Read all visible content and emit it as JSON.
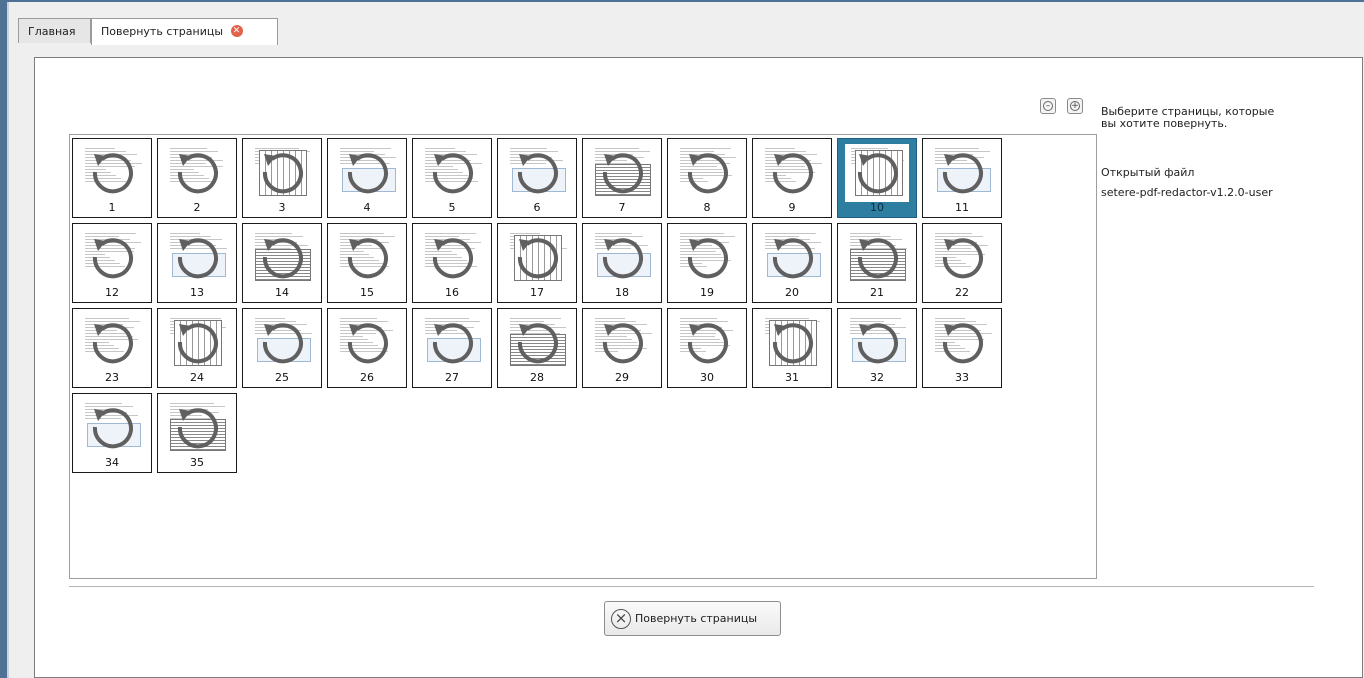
{
  "tabs": [
    {
      "label": "Главная",
      "active": false
    },
    {
      "label": "Повернуть страницы",
      "active": true,
      "closable": true
    }
  ],
  "colors": {
    "accent": "#4f7194",
    "selected_tile": "#2d7ea1",
    "tab_close": "#e2624a",
    "rotate_icon": "#606060"
  },
  "zoom": {
    "out_icon": "zoom-out-icon",
    "in_icon": "zoom-in-icon"
  },
  "pages": [
    {
      "number": "1",
      "selected": false
    },
    {
      "number": "2",
      "selected": false
    },
    {
      "number": "3",
      "selected": false
    },
    {
      "number": "4",
      "selected": false
    },
    {
      "number": "5",
      "selected": false
    },
    {
      "number": "6",
      "selected": false
    },
    {
      "number": "7",
      "selected": false
    },
    {
      "number": "8",
      "selected": false
    },
    {
      "number": "9",
      "selected": false
    },
    {
      "number": "10",
      "selected": true
    },
    {
      "number": "11",
      "selected": false
    },
    {
      "number": "12",
      "selected": false
    },
    {
      "number": "13",
      "selected": false
    },
    {
      "number": "14",
      "selected": false
    },
    {
      "number": "15",
      "selected": false
    },
    {
      "number": "16",
      "selected": false
    },
    {
      "number": "17",
      "selected": false
    },
    {
      "number": "18",
      "selected": false
    },
    {
      "number": "19",
      "selected": false
    },
    {
      "number": "20",
      "selected": false
    },
    {
      "number": "21",
      "selected": false
    },
    {
      "number": "22",
      "selected": false
    },
    {
      "number": "23",
      "selected": false
    },
    {
      "number": "24",
      "selected": false
    },
    {
      "number": "25",
      "selected": false
    },
    {
      "number": "26",
      "selected": false
    },
    {
      "number": "27",
      "selected": false
    },
    {
      "number": "28",
      "selected": false
    },
    {
      "number": "29",
      "selected": false
    },
    {
      "number": "30",
      "selected": false
    },
    {
      "number": "31",
      "selected": false
    },
    {
      "number": "32",
      "selected": false
    },
    {
      "number": "33",
      "selected": false
    },
    {
      "number": "34",
      "selected": false
    },
    {
      "number": "35",
      "selected": false
    }
  ],
  "action": {
    "rotate_label": "Повернуть страницы",
    "icon": "cancel-circle-icon"
  },
  "side": {
    "instruction": "Выберите страницы, которые вы хотите повернуть.",
    "file_label": "Открытый файл",
    "file_name": "setere-pdf-redactor-v1.2.0-user"
  }
}
